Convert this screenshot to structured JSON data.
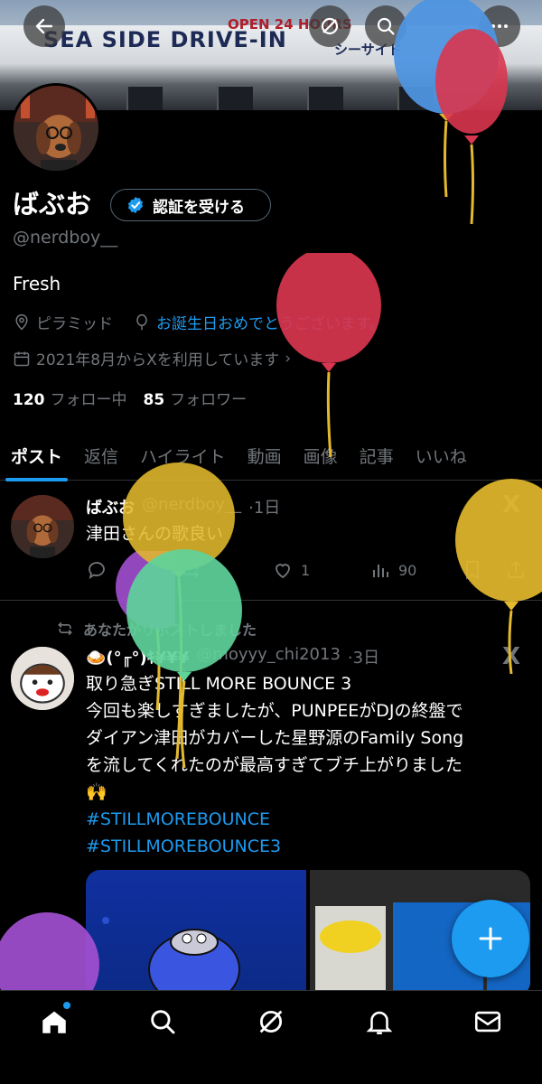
{
  "banner": {
    "sign_main": "SEA SIDE DRIVE-IN",
    "sign_top": "OPEN 24 HOURS",
    "sign_jp": "シーサイド"
  },
  "profile": {
    "name": "ばぶお",
    "verify_label": "認証を受ける",
    "handle": "@nerdboy__",
    "bio": "Fresh",
    "location": "ピラミッド",
    "birthday_text": "お誕生日おめでとうございます。",
    "joined": "2021年8月からXを利用しています",
    "following_count": "120",
    "following_label": "フォロー中",
    "followers_count": "85",
    "followers_label": "フォロワー"
  },
  "tabs": [
    "ポスト",
    "返信",
    "ハイライト",
    "動画",
    "画像",
    "記事",
    "いいね"
  ],
  "post1": {
    "name": "ばぶお",
    "handle": "@nerdboy__",
    "time": "·1日",
    "text": "津田さんの歌良い",
    "likes": "1",
    "views": "90"
  },
  "repost_label": "あなたがリポストしました",
  "post2": {
    "name": "🍛(°╓°)ｷ¥¥¥",
    "handle": "@moyyy_chi2013",
    "time": "·3日",
    "line1": "取り急ぎSTILL MORE BOUNCE 3",
    "line2": "今回も楽しすぎましたが、PUNPEEがDJの終盤で",
    "line3": "ダイアン津田がカバーした星野源のFamily Song",
    "line4": "を流してくれたのが最高すぎてブチ上がりました",
    "emoji": "🙌",
    "tag1": "#STILLMOREBOUNCE",
    "tag2": "#STILLMOREBOUNCE3"
  },
  "colors": {
    "accent": "#1d9bf0",
    "background": "#000000",
    "muted": "#71767b",
    "balloon_blue": "#4f95e0",
    "balloon_red": "#d9364f",
    "balloon_yellow": "#e3b92e",
    "balloon_green": "#5ed39a",
    "balloon_purple": "#a24fd0"
  }
}
